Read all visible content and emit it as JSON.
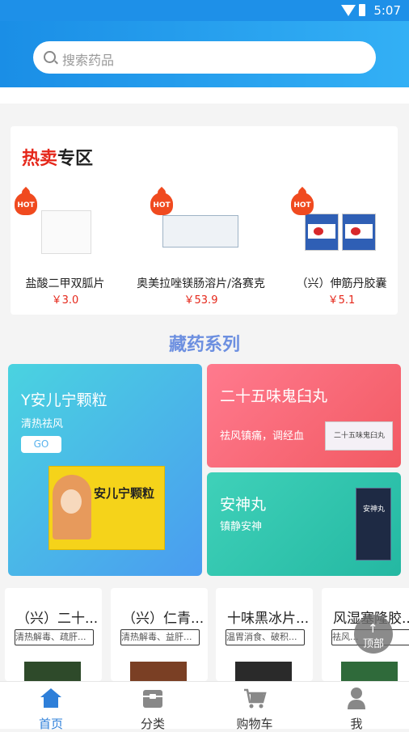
{
  "status_bar": {
    "time": "5:07"
  },
  "search": {
    "placeholder": "搜索药品"
  },
  "hot": {
    "title_red": "热卖",
    "title_black": "专区",
    "badge": "HOT",
    "products": [
      {
        "name": "盐酸二甲双胍片",
        "price": "￥3.0"
      },
      {
        "name": "奥美拉唑镁肠溶片/洛赛克",
        "price": "￥53.9"
      },
      {
        "name": "（兴）伸筋丹胶囊",
        "price": "￥5.1"
      }
    ]
  },
  "series": {
    "title": "藏药系列",
    "cards": [
      {
        "title": "Y安儿宁颗粒",
        "subtitle": "清热祛风",
        "button": "GO",
        "package_text": "安儿宁颗粒"
      },
      {
        "title": "二十五味鬼臼丸",
        "subtitle": "祛风镇痛，调经血",
        "package_text": "二十五味鬼臼丸"
      },
      {
        "title": "安神丸",
        "subtitle": "镇静安神",
        "package_text": "安神丸"
      }
    ]
  },
  "product_row": [
    {
      "name": "（兴）二十...",
      "tag": "清热解毒、疏肝..."
    },
    {
      "name": "（兴）仁青...",
      "tag": "清热解毒、益肝..."
    },
    {
      "name": "十味黑冰片...",
      "tag": "温胃消食、破积..."
    },
    {
      "name": "风湿塞隆胶...",
      "tag": "祛风..."
    }
  ],
  "back_to_top": {
    "label": "顶部",
    "arrow": "↑"
  },
  "tabbar": [
    {
      "label": "首页",
      "active": true,
      "icon": "home-icon"
    },
    {
      "label": "分类",
      "active": false,
      "icon": "category-icon"
    },
    {
      "label": "购物车",
      "active": false,
      "icon": "cart-icon"
    },
    {
      "label": "我",
      "active": false,
      "icon": "user-icon"
    }
  ],
  "colors": {
    "primary": "#1e90e8",
    "price_red": "#e5271a",
    "active_tab": "#2e7fd9"
  }
}
